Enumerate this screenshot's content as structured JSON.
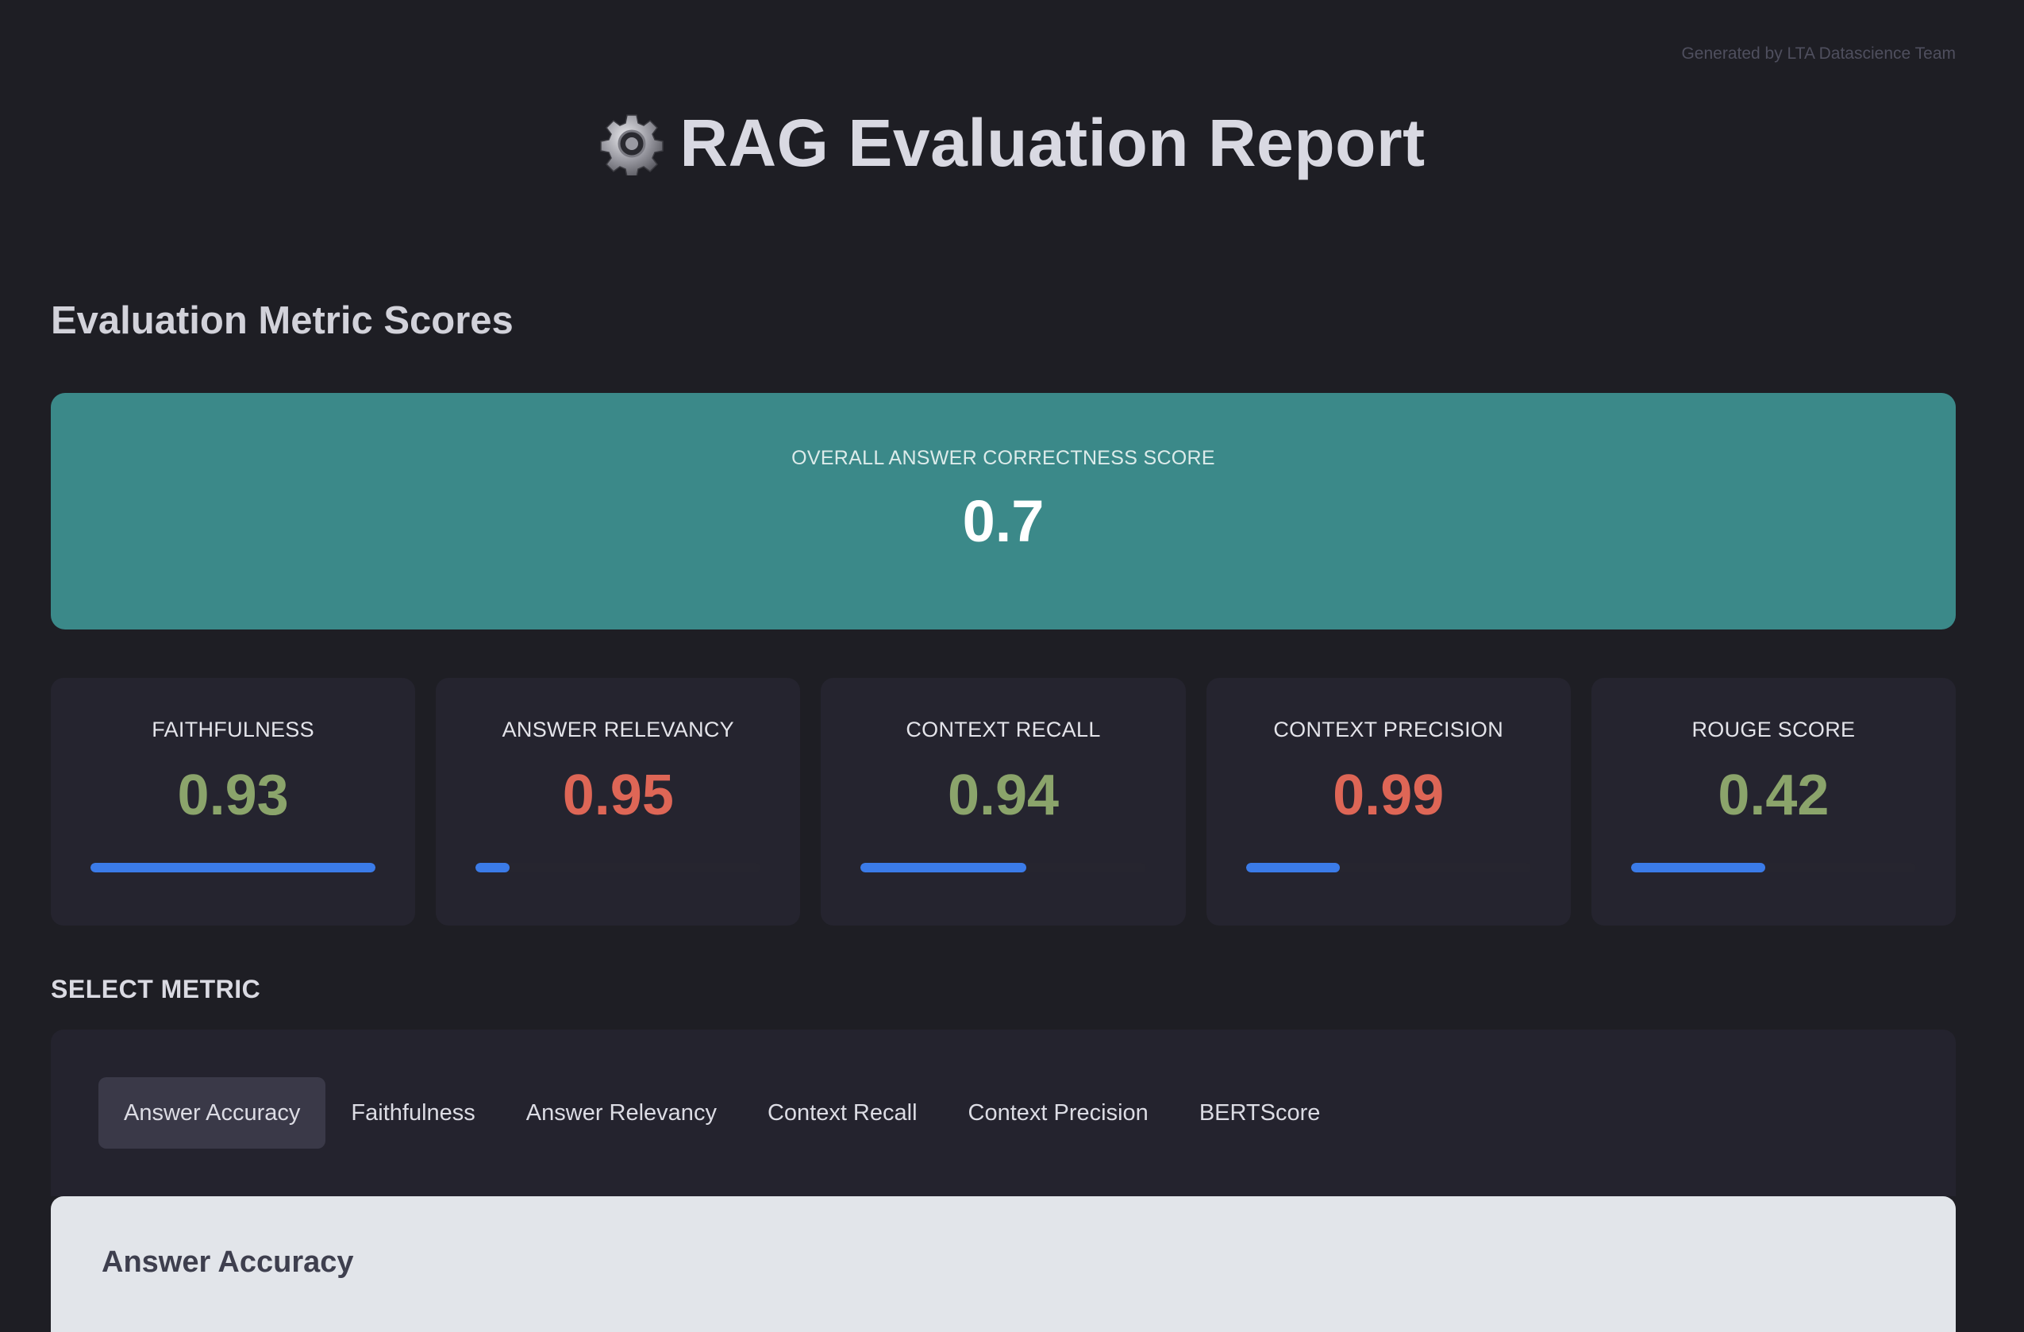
{
  "header": {
    "credit": "Generated by LTA Datascience Team",
    "icon": "gear-icon",
    "title": "RAG Evaluation Report"
  },
  "scores": {
    "section_title": "Evaluation Metric Scores",
    "overall": {
      "label": "OVERALL ANSWER CORRECTNESS SCORE",
      "value": "0.7"
    },
    "metrics": [
      {
        "label": "FAITHFULNESS",
        "value": "0.93",
        "color": "#8ba46b",
        "bar_fraction": 1.0
      },
      {
        "label": "ANSWER RELEVANCY",
        "value": "0.95",
        "color": "#de6656",
        "bar_fraction": 0.12
      },
      {
        "label": "CONTEXT RECALL",
        "value": "0.94",
        "color": "#8ba46b",
        "bar_fraction": 0.58
      },
      {
        "label": "CONTEXT PRECISION",
        "value": "0.99",
        "color": "#de6656",
        "bar_fraction": 0.33
      },
      {
        "label": "ROUGE SCORE",
        "value": "0.42",
        "color": "#8ba46b",
        "bar_fraction": 0.47
      }
    ],
    "bar_color": "#3b7be8"
  },
  "selector": {
    "label": "SELECT METRIC",
    "active_index": 0,
    "tabs": [
      "Answer Accuracy",
      "Faithfulness",
      "Answer Relevancy",
      "Context Recall",
      "Context Precision",
      "BERTScore"
    ]
  },
  "content": {
    "title": "Answer Accuracy"
  }
}
